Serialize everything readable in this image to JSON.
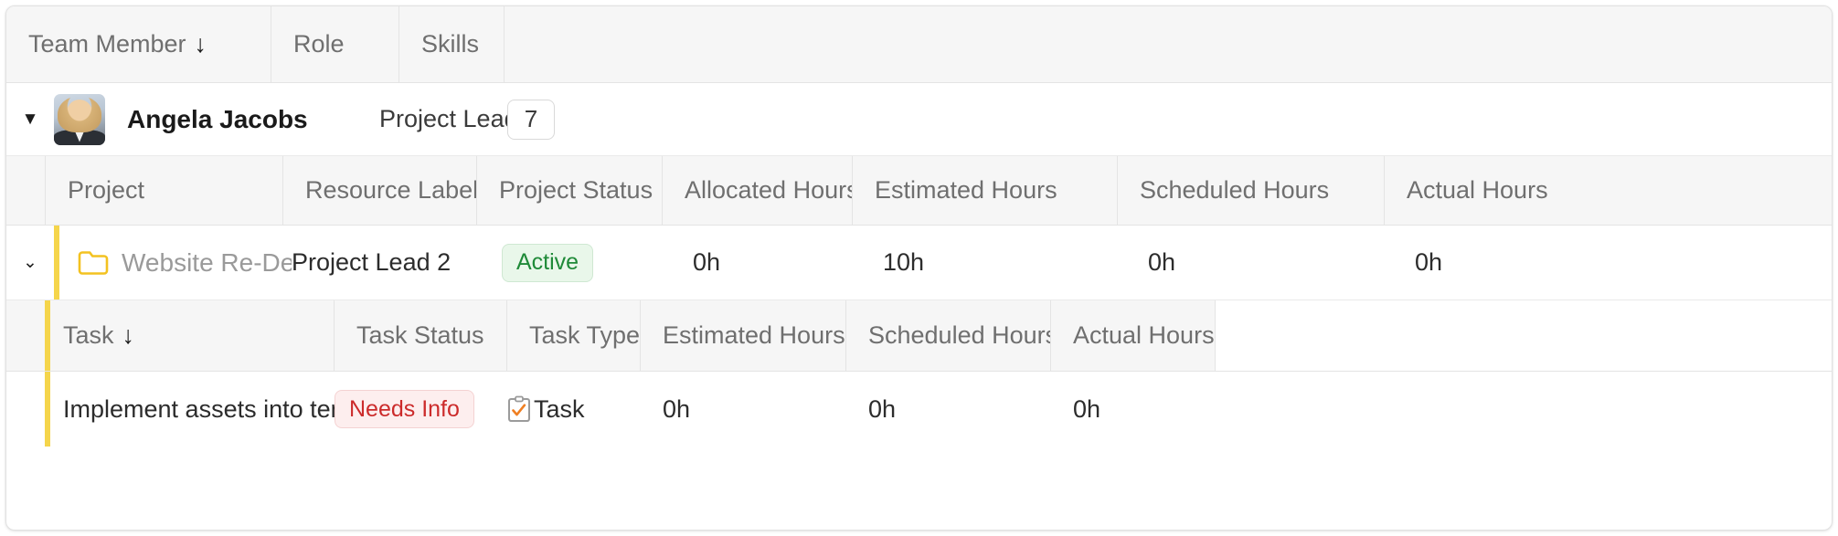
{
  "member_grid": {
    "columns": [
      {
        "label": "Team Member",
        "sorted": true,
        "sort_glyph": "↓"
      },
      {
        "label": "Role",
        "sorted": false
      },
      {
        "label": "Skills",
        "sorted": false
      }
    ],
    "row": {
      "expand_glyph": "▼",
      "avatar_alt": "Angela Jacobs avatar",
      "name": "Angela Jacobs",
      "role": "Project Lead",
      "skills_count": "7"
    }
  },
  "project_grid": {
    "columns": [
      {
        "label": "Project"
      },
      {
        "label": "Resource Label"
      },
      {
        "label": "Project Status"
      },
      {
        "label": "Allocated Hours"
      },
      {
        "label": "Estimated Hours"
      },
      {
        "label": "Scheduled Hours"
      },
      {
        "label": "Actual Hours"
      }
    ],
    "row": {
      "expand_glyph": "⌄",
      "folder_icon": "folder-icon",
      "name": "Website Re-Design",
      "resource_label": "Project Lead 2",
      "status": "Active",
      "allocated_hours": "0h",
      "estimated_hours": "10h",
      "scheduled_hours": "0h",
      "actual_hours": "0h"
    }
  },
  "task_grid": {
    "columns": [
      {
        "label": "Task",
        "sorted": true,
        "sort_glyph": "↓"
      },
      {
        "label": "Task Status"
      },
      {
        "label": "Task Type"
      },
      {
        "label": "Estimated Hours"
      },
      {
        "label": "Scheduled Hours"
      },
      {
        "label": "Actual Hours"
      },
      {
        "label": ""
      }
    ],
    "row": {
      "name": "Implement assets into templates",
      "status": "Needs Info",
      "type": "Task",
      "type_icon": "clipboard-check-icon",
      "estimated_hours": "0h",
      "scheduled_hours": "0h",
      "actual_hours": "0h"
    }
  },
  "colors": {
    "accent_bar": "#f5d54b",
    "folder": "#f3c220",
    "status_active_text": "#1f8a38",
    "status_active_bg": "#e9f7ea",
    "status_needsinfo_text": "#cc2b2b",
    "status_needsinfo_bg": "#fdeeee",
    "task_check": "#ef7f23",
    "header_bg": "#f6f6f6"
  }
}
